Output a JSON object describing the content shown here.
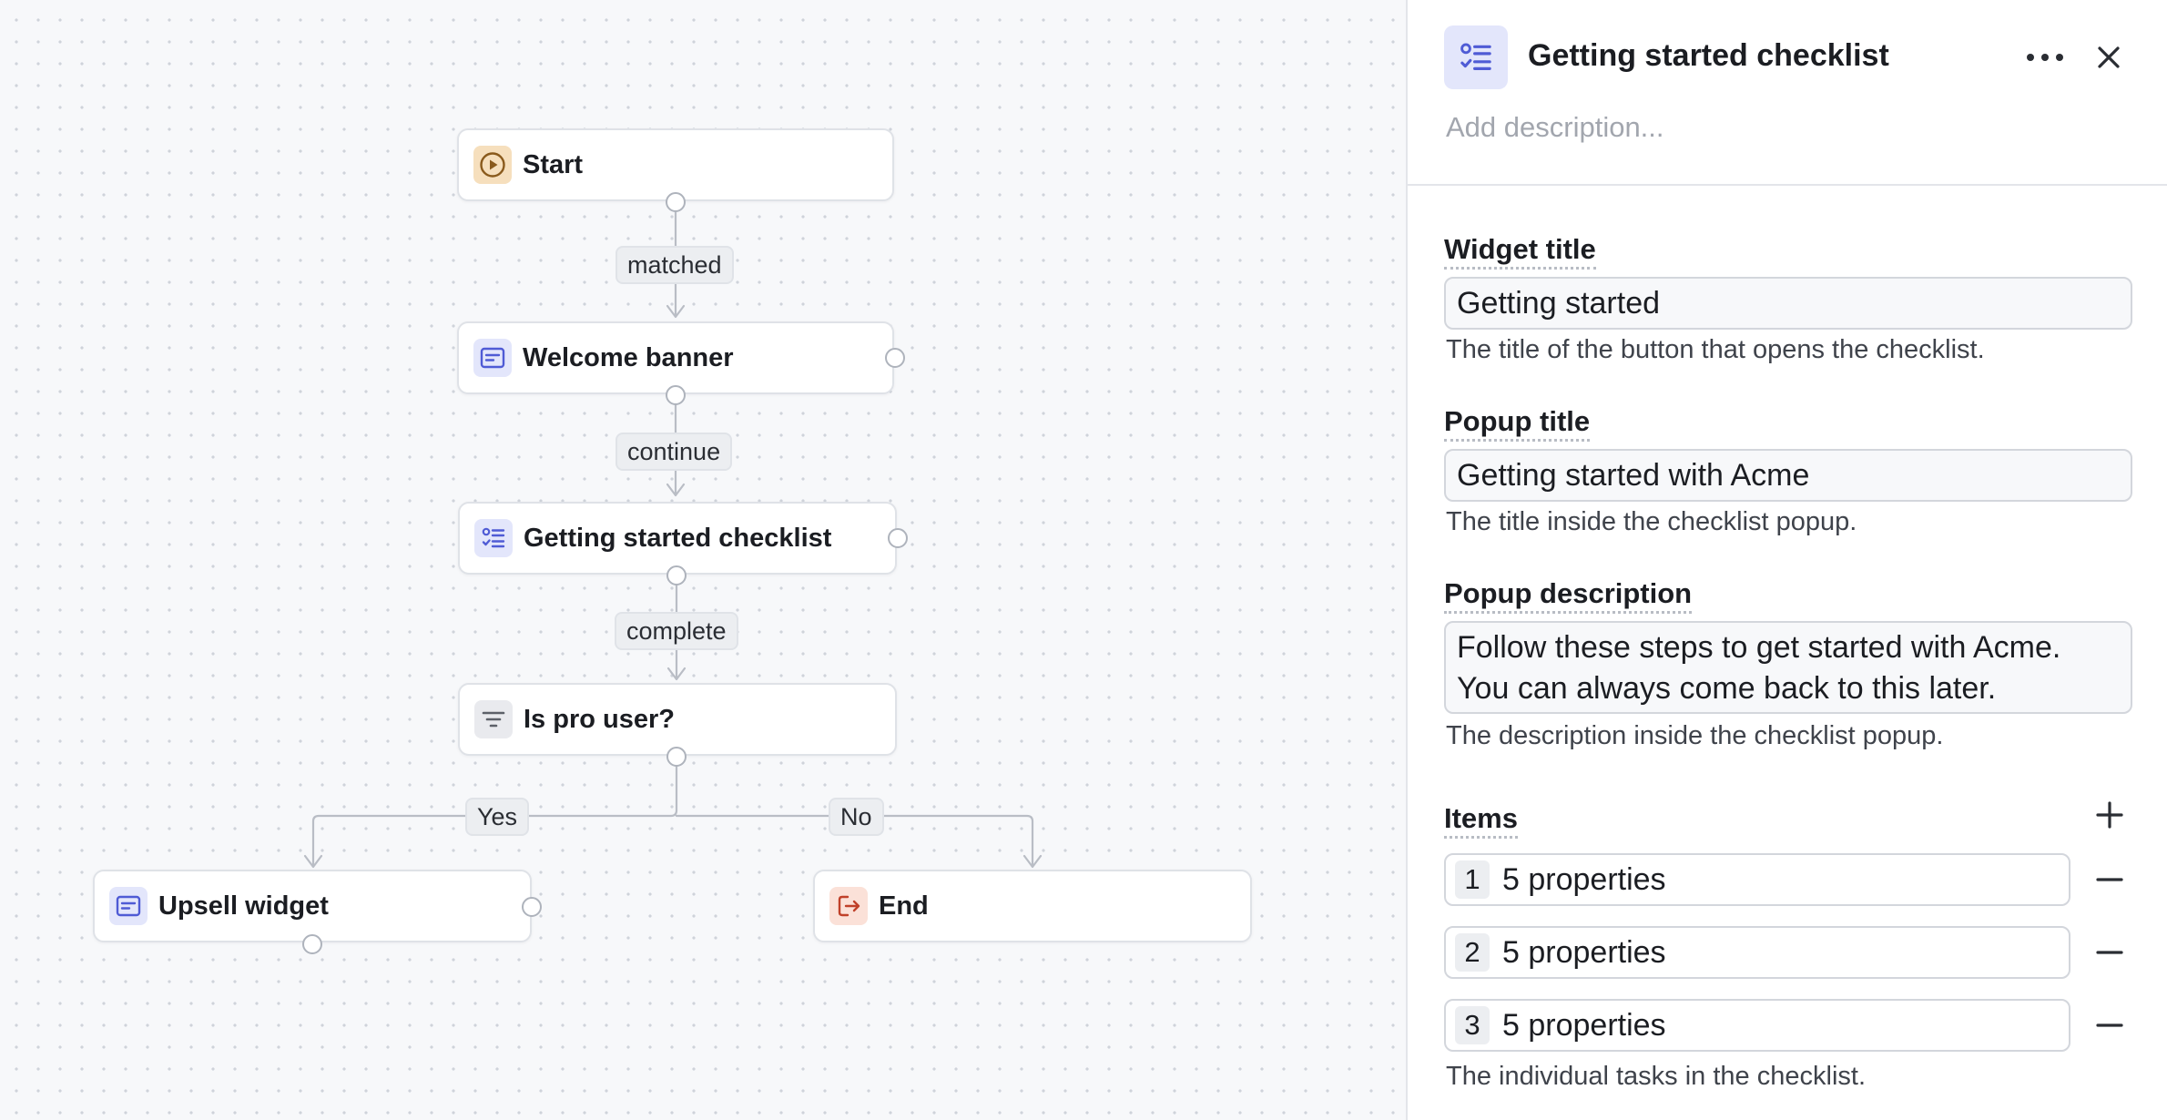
{
  "flow": {
    "nodes": {
      "start": {
        "label": "Start",
        "icon": "play-circle-icon"
      },
      "welcome": {
        "label": "Welcome banner",
        "icon": "banner-icon"
      },
      "checklist": {
        "label": "Getting started checklist",
        "icon": "checklist-icon"
      },
      "pro": {
        "label": "Is pro user?",
        "icon": "filter-icon"
      },
      "upsell": {
        "label": "Upsell widget",
        "icon": "banner-icon"
      },
      "end": {
        "label": "End",
        "icon": "exit-icon"
      }
    },
    "edges": {
      "matched": "matched",
      "continue": "continue",
      "complete": "complete",
      "yes": "Yes",
      "no": "No"
    }
  },
  "panel": {
    "title": "Getting started checklist",
    "description_placeholder": "Add description...",
    "widget_title": {
      "label": "Widget title",
      "value": "Getting started",
      "help": "The title of the button that opens the checklist."
    },
    "popup_title": {
      "label": "Popup title",
      "value": "Getting started with Acme",
      "help": "The title inside the checklist popup."
    },
    "popup_description": {
      "label": "Popup description",
      "line1": "Follow these steps to get started with Acme.",
      "line2": "You can always come back to this later.",
      "help": "The description inside the checklist popup."
    },
    "items": {
      "label": "Items",
      "list": [
        {
          "num": "1",
          "text": "5 properties"
        },
        {
          "num": "2",
          "text": "5 properties"
        },
        {
          "num": "3",
          "text": "5 properties"
        }
      ],
      "help": "The individual tasks in the checklist."
    }
  },
  "colors": {
    "accent": "#4f5bd5",
    "start_icon": "#8a5a1c",
    "end_icon": "#c0412a",
    "edge": "#b9bdc5"
  }
}
